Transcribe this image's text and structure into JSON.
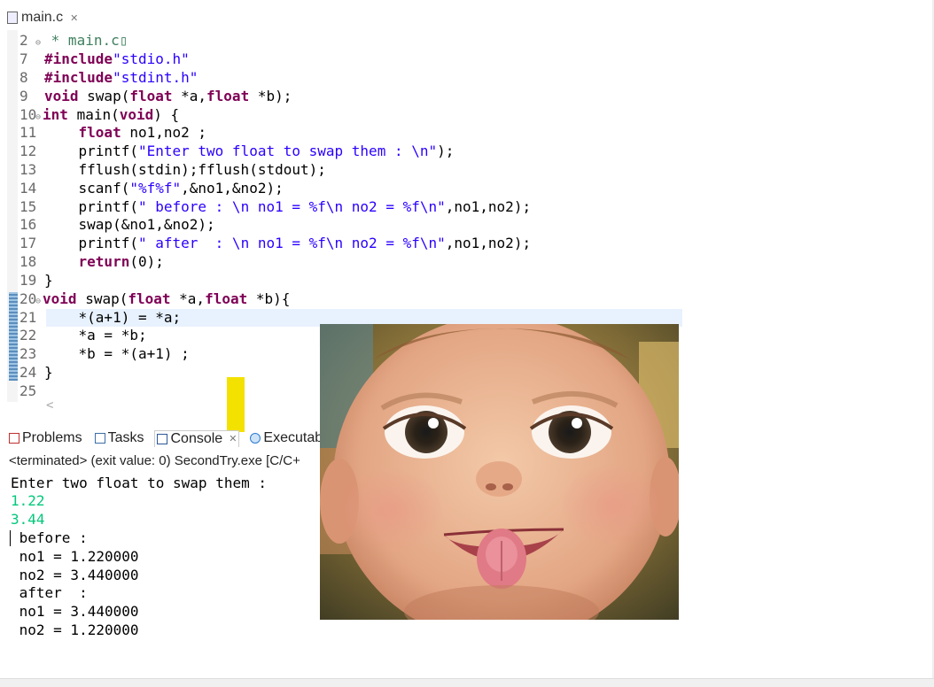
{
  "editor": {
    "tab_label": "main.c",
    "close_glyph": "✕",
    "scroll_arrow": "<",
    "lines": [
      {
        "n": "2",
        "fold": "⊖",
        "segments": [
          {
            "t": " * main.c",
            "c": "cmt"
          },
          {
            "t": "▯",
            "c": "cmt"
          }
        ]
      },
      {
        "n": "7",
        "segments": [
          {
            "t": "#include",
            "c": "kw"
          },
          {
            "t": "\"stdio.h\"",
            "c": "str"
          }
        ]
      },
      {
        "n": "8",
        "segments": [
          {
            "t": "#include",
            "c": "kw"
          },
          {
            "t": "\"stdint.h\"",
            "c": "str"
          }
        ]
      },
      {
        "n": "9",
        "segments": [
          {
            "t": "void",
            "c": "kw"
          },
          {
            "t": " swap(",
            "c": ""
          },
          {
            "t": "float",
            "c": "kw"
          },
          {
            "t": " *a,",
            "c": ""
          },
          {
            "t": "float",
            "c": "kw"
          },
          {
            "t": " *b);",
            "c": ""
          }
        ]
      },
      {
        "n": "10",
        "fold": "⊖",
        "segments": [
          {
            "t": "int",
            "c": "kw"
          },
          {
            "t": " main(",
            "c": ""
          },
          {
            "t": "void",
            "c": "kw"
          },
          {
            "t": ") {",
            "c": ""
          }
        ]
      },
      {
        "n": "11",
        "segments": [
          {
            "t": "    ",
            "c": ""
          },
          {
            "t": "float",
            "c": "kw"
          },
          {
            "t": " no1,no2 ;",
            "c": ""
          }
        ]
      },
      {
        "n": "12",
        "segments": [
          {
            "t": "    printf(",
            "c": ""
          },
          {
            "t": "\"Enter two float to swap them : \\n\"",
            "c": "str"
          },
          {
            "t": ");",
            "c": ""
          }
        ]
      },
      {
        "n": "13",
        "segments": [
          {
            "t": "    fflush(stdin);fflush(stdout);",
            "c": ""
          }
        ]
      },
      {
        "n": "14",
        "segments": [
          {
            "t": "    scanf(",
            "c": ""
          },
          {
            "t": "\"%f%f\"",
            "c": "str"
          },
          {
            "t": ",&no1,&no2);",
            "c": ""
          }
        ]
      },
      {
        "n": "15",
        "segments": [
          {
            "t": "    printf(",
            "c": ""
          },
          {
            "t": "\" before : \\n no1 = %f\\n no2 = %f\\n\"",
            "c": "str"
          },
          {
            "t": ",no1,no2);",
            "c": ""
          }
        ]
      },
      {
        "n": "16",
        "segments": [
          {
            "t": "    swap(&no1,&no2);",
            "c": ""
          }
        ]
      },
      {
        "n": "17",
        "segments": [
          {
            "t": "    printf(",
            "c": ""
          },
          {
            "t": "\" after  : \\n no1 = %f\\n no2 = %f\\n\"",
            "c": "str"
          },
          {
            "t": ",no1,no2);",
            "c": ""
          }
        ]
      },
      {
        "n": "18",
        "segments": [
          {
            "t": "    ",
            "c": ""
          },
          {
            "t": "return",
            "c": "kw"
          },
          {
            "t": "(0);",
            "c": ""
          }
        ]
      },
      {
        "n": "19",
        "segments": [
          {
            "t": "}",
            "c": ""
          }
        ]
      },
      {
        "n": "20",
        "fold": "⊖",
        "segments": [
          {
            "t": "void",
            "c": "kw"
          },
          {
            "t": " swap(",
            "c": ""
          },
          {
            "t": "float",
            "c": "kw"
          },
          {
            "t": " *a,",
            "c": ""
          },
          {
            "t": "float",
            "c": "kw"
          },
          {
            "t": " *b){",
            "c": ""
          }
        ]
      },
      {
        "n": "21",
        "segments": [
          {
            "t": "    *(a+1) = *a;",
            "c": ""
          }
        ]
      },
      {
        "n": "22",
        "segments": [
          {
            "t": "    *a = *b;",
            "c": ""
          }
        ]
      },
      {
        "n": "23",
        "segments": [
          {
            "t": "    *b = *(a+1) ;",
            "c": ""
          }
        ]
      },
      {
        "n": "24",
        "segments": [
          {
            "t": "}",
            "c": ""
          }
        ]
      },
      {
        "n": "25",
        "segments": []
      }
    ]
  },
  "bottom_panel": {
    "tabs": [
      {
        "label": "Problems",
        "icon": "problems-icon",
        "active": false
      },
      {
        "label": "Tasks",
        "icon": "tasks-icon",
        "active": false
      },
      {
        "label": "Console",
        "icon": "console-icon",
        "active": true
      },
      {
        "label": "Executab",
        "icon": "executables-icon",
        "active": false
      }
    ],
    "close_glyph": "✕",
    "status": "<terminated> (exit value: 0) SecondTry.exe [C/C+",
    "console_lines": [
      {
        "text": "Enter two float to swap them :",
        "kind": "out"
      },
      {
        "text": "1.22",
        "kind": "in"
      },
      {
        "text": "3.44",
        "kind": "in"
      },
      {
        "text": " before :",
        "kind": "out"
      },
      {
        "text": " no1 = 1.220000",
        "kind": "out"
      },
      {
        "text": " no2 = 3.440000",
        "kind": "out"
      },
      {
        "text": " after  :",
        "kind": "out"
      },
      {
        "text": " no1 = 3.440000",
        "kind": "out"
      },
      {
        "text": " no2 = 1.220000",
        "kind": "out"
      }
    ]
  },
  "colors": {
    "keyword": "#7f0055",
    "string": "#2a00ff",
    "comment": "#3f7f5f",
    "console_input": "#00c87a",
    "highlight": "#f3e100"
  }
}
